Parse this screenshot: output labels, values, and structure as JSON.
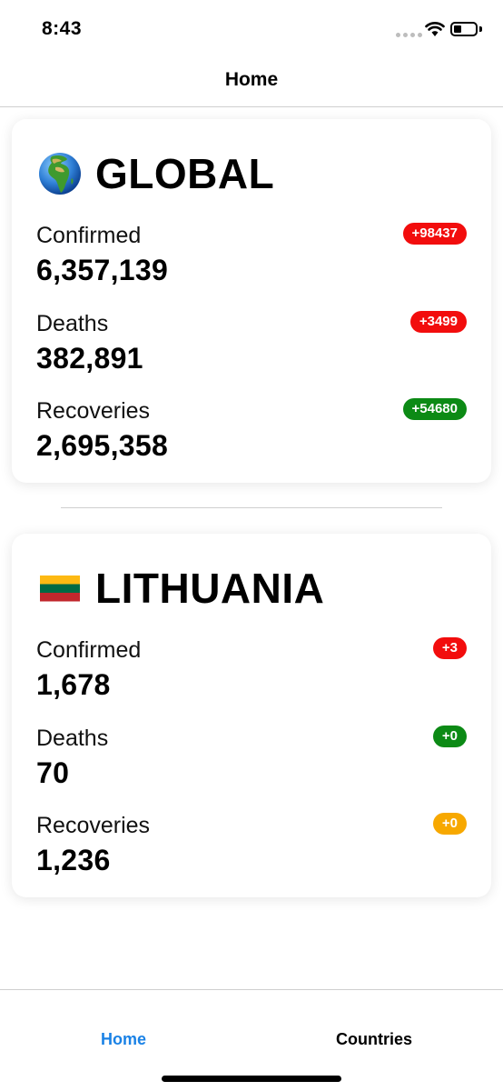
{
  "status_bar": {
    "time": "8:43"
  },
  "nav": {
    "title": "Home"
  },
  "global": {
    "title": "GLOBAL",
    "flag_icon": "globe-africa-europe",
    "stats": [
      {
        "label": "Confirmed",
        "value": "6,357,139",
        "badge": "+98437",
        "badge_color": "#f20d0d"
      },
      {
        "label": "Deaths",
        "value": "382,891",
        "badge": "+3499",
        "badge_color": "#f20d0d"
      },
      {
        "label": "Recoveries",
        "value": "2,695,358",
        "badge": "+54680",
        "badge_color": "#0c8a15"
      }
    ]
  },
  "country": {
    "title": "LITHUANIA",
    "flag_icon": "flag-lithuania",
    "stats": [
      {
        "label": "Confirmed",
        "value": "1,678",
        "badge": "+3",
        "badge_color": "#f20d0d"
      },
      {
        "label": "Deaths",
        "value": "70",
        "badge": "+0",
        "badge_color": "#0c8a15"
      },
      {
        "label": "Recoveries",
        "value": "1,236",
        "badge": "+0",
        "badge_color": "#f7a800"
      }
    ]
  },
  "tabs": [
    {
      "label": "Home",
      "active": true
    },
    {
      "label": "Countries",
      "active": false
    }
  ],
  "colors": {
    "accent": "#1a82e6",
    "danger": "#f20d0d",
    "success": "#0c8a15",
    "warning": "#f7a800"
  }
}
